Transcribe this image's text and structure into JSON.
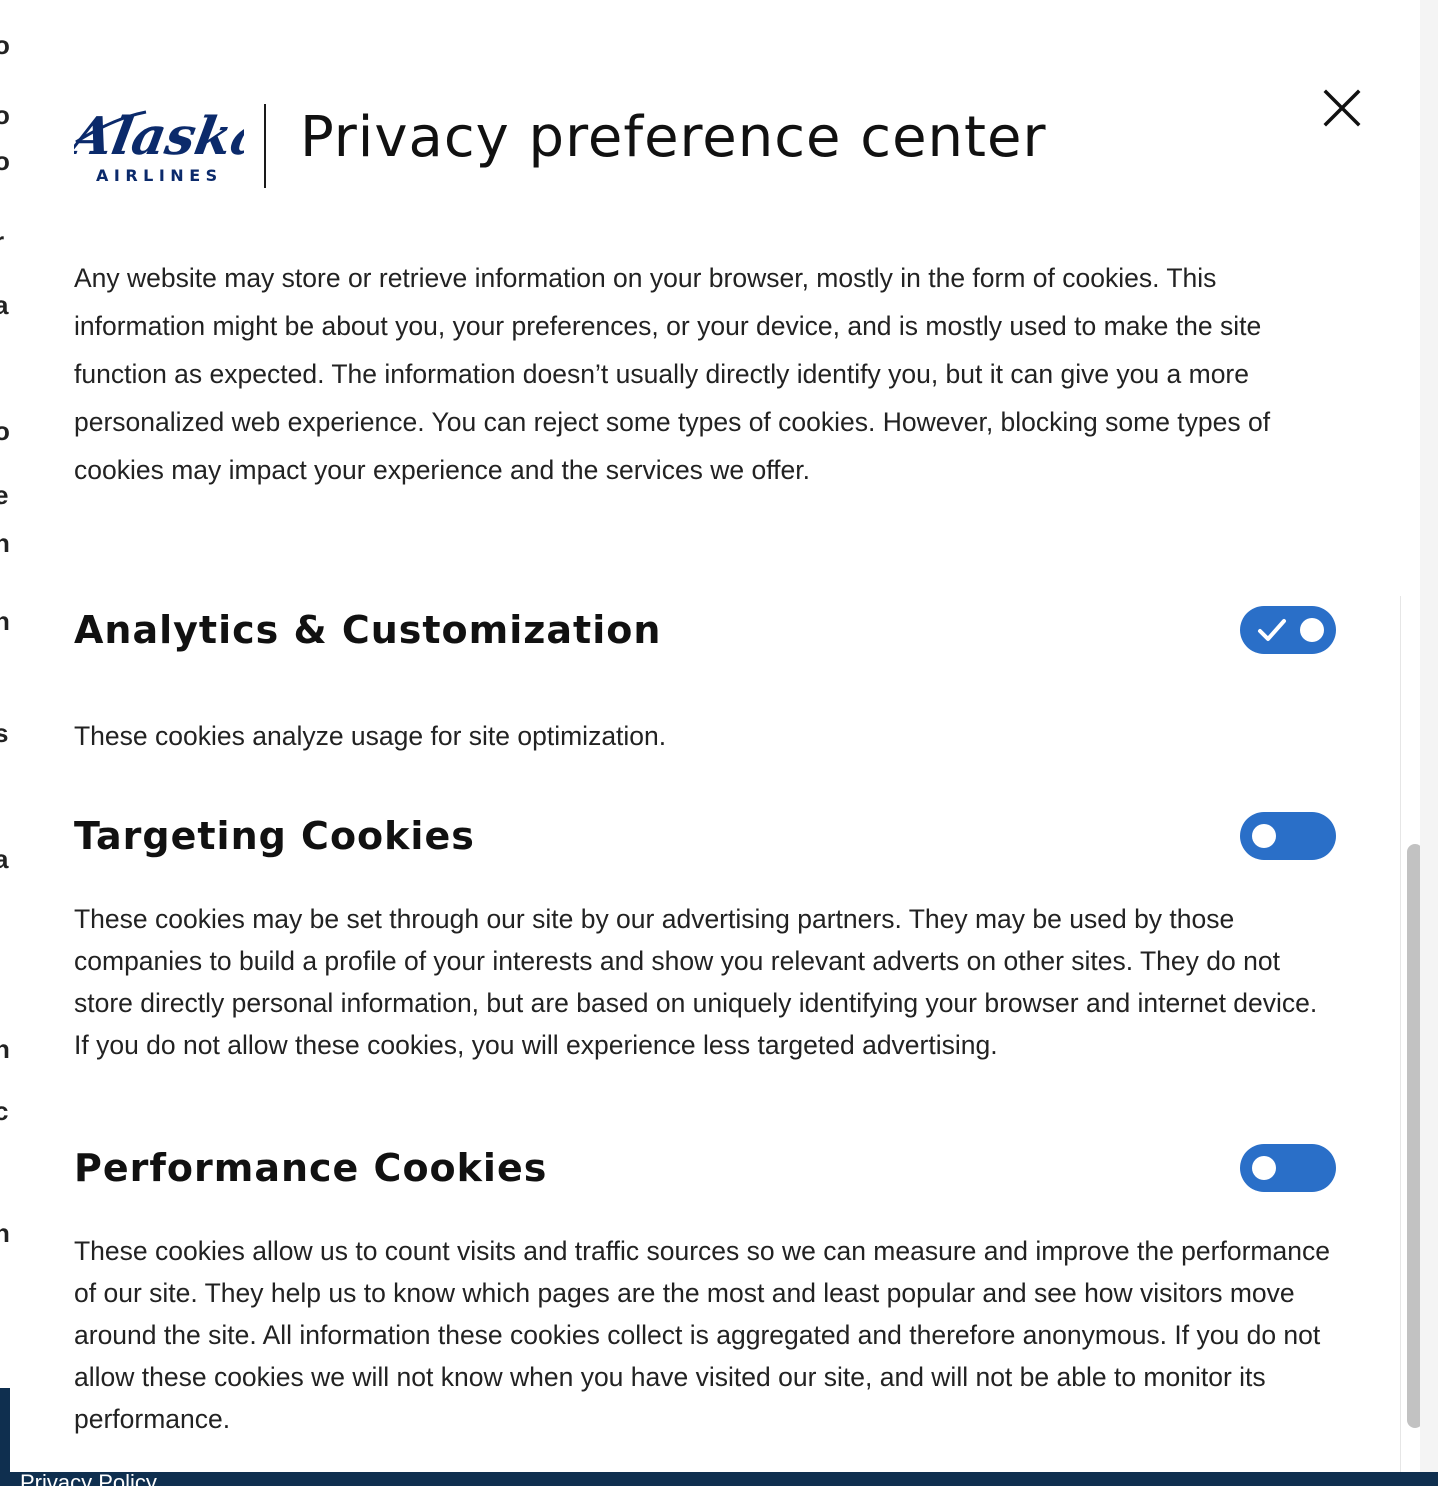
{
  "background": {
    "footer_link": "Privacy Policy"
  },
  "header": {
    "logo_wordmark": "Alaska",
    "logo_subtext": "AIRLINES",
    "title": "Privacy preference center",
    "close_icon": "close-icon"
  },
  "intro": "Any website may store or retrieve information on your browser, mostly in the form of cookies. This information might be about you, your preferences, or your device, and is mostly used to make the site function as expected. The information doesn’t usually directly identify you, but it can give you a more personalized web experience. You can reject some types of cookies. However, blocking some types of cookies may impact your experience and the services we offer.",
  "sections": [
    {
      "title": "Analytics & Customization",
      "description": "These cookies analyze usage for site optimization.",
      "enabled": true
    },
    {
      "title": "Targeting Cookies",
      "description": "These cookies may be set through our site by our advertising partners. They may be used by those companies to build a profile of your interests and show you relevant adverts on other sites. They do not store directly personal information, but are based on uniquely identifying your browser and internet device. If you do not allow these cookies, you will experience less targeted advertising.",
      "enabled": false
    },
    {
      "title": "Performance Cookies",
      "description": "These cookies allow us to count visits and traffic sources so we can measure and improve the performance of our site. They help us to know which pages are the most and least popular and see how visitors move around the site. All information these cookies collect is aggregated and therefore anonymous. If you do not allow these cookies we will not know when you have visited our site, and will not be able to monitor its performance.",
      "enabled": false
    }
  ],
  "colors": {
    "toggle": "#2a6fc8",
    "brand_navy": "#0f2f4f",
    "logo_navy": "#0b2a6b"
  }
}
